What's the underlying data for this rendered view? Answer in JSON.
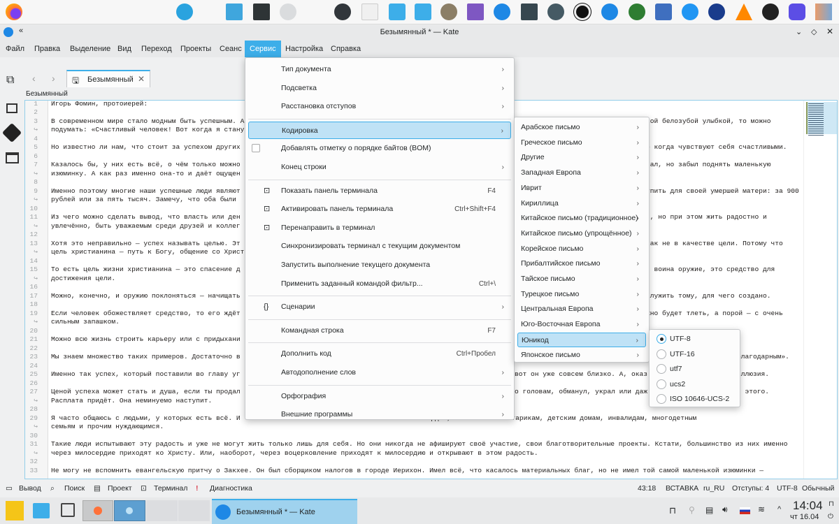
{
  "window": {
    "title": "Безымянный * — Kate"
  },
  "menubar": [
    "Файл",
    "Правка",
    "Выделение",
    "Вид",
    "Переход",
    "Проекты",
    "Сеанс",
    "Сервис",
    "Настройка",
    "Справка"
  ],
  "tab": {
    "label": "Безымянный"
  },
  "doc_label": "Безымянный",
  "editor": {
    "rows": [
      {
        "n": "1",
        "l": "Игорь Фомин, протоиерей:"
      },
      {
        "n": "2",
        "l": ""
      },
      {
        "n": "3",
        "l": "В современном мире стало модным быть успешным. А",
        "r": "кой белозубой улыбкой, то можно"
      },
      {
        "n": "↪",
        "l": "подумать: «Счастливый человек! Вот когда я стану"
      },
      {
        "n": "4",
        "l": ""
      },
      {
        "n": "5",
        "l": "Но известно ли нам, что стоит за успехом других",
        "r": "о когда чувствуют себя счастливыми."
      },
      {
        "n": "6",
        "l": ""
      },
      {
        "n": "7",
        "l": "Казалось бы, у них есть всё, о чём только можно",
        "r": "вал, но забыл поднять маленькую"
      },
      {
        "n": "↪",
        "l": "изюминку. А как раз именно она-то и даёт ощущен"
      },
      {
        "n": "8",
        "l": ""
      },
      {
        "n": "9",
        "l": "Именно поэтому многие наши успешные люди являют",
        "r": "упить для своей умершей матери: за 900"
      },
      {
        "n": "↪",
        "l": "рублей или за пять тысяч. Замечу, что оба были"
      },
      {
        "n": "10",
        "l": ""
      },
      {
        "n": "11",
        "l": "Из чего можно сделать вывод, что власть или ден",
        "r": "и, но при этом жить радостно и"
      },
      {
        "n": "↪",
        "l": "увлечённо, быть уважаемым среди друзей и коллег"
      },
      {
        "n": "12",
        "l": ""
      },
      {
        "n": "13",
        "l": "Хотя это неправильно — успех называть целью. Эт",
        "r": "как не в качестве цели. Потому что"
      },
      {
        "n": "↪",
        "l": "цель христианина — путь к Богу, общение со Христ"
      },
      {
        "n": "14",
        "l": ""
      },
      {
        "n": "15",
        "l": "То есть цель жизни христианина — это спасение д",
        "r": "и воина оружие, это средство для"
      },
      {
        "n": "↪",
        "l": "достижения цели."
      },
      {
        "n": "16",
        "l": ""
      },
      {
        "n": "17",
        "l": "Можно, конечно, и оружию поклоняться — начищать",
        "r": "служить тому, для чего создано."
      },
      {
        "n": "18",
        "l": ""
      },
      {
        "n": "19",
        "l": "Если человек обожествляет средство, то его ждёт",
        "r": "жно будет тлеть, а порой — с очень"
      },
      {
        "n": "↪",
        "l": "сильным запашком."
      },
      {
        "n": "20",
        "l": ""
      },
      {
        "n": "21",
        "l": "Можно всю жизнь строить карьеру или с придыхани"
      },
      {
        "n": "22",
        "l": ""
      },
      {
        "n": "23",
        "l": "Мы знаем множество таких примеров. Достаточно в",
        "r2": "благодарным»."
      },
      {
        "n": "24",
        "l": ""
      },
      {
        "n": "25",
        "l": "Именно так успех, который поставили во главу уг",
        "m": "вот он уже совсем близко. А, оказ",
        "r2": "иллюзия."
      },
      {
        "n": "26",
        "l": ""
      },
      {
        "n": "27",
        "l": "Ценой успеха может стать и душа, если ты продал",
        "m": "о головам, обманул, украл или даж",
        "r2": "и этого."
      },
      {
        "n": "↪",
        "l": "Расплата придёт. Она неминуемо наступит."
      },
      {
        "n": "28",
        "l": ""
      },
      {
        "n": "29",
        "l": "Я часто общаюсь с людьми, у которых есть всё. И",
        "b": "осердие, кто помогает старикам, детским домам, инвалидам, многодетным"
      },
      {
        "n": "↪",
        "l": "семьям и прочим нуждающимся."
      },
      {
        "n": "30",
        "l": ""
      },
      {
        "n": "31",
        "l": "Такие люди испытывают эту радость и уже не могут жить только лишь для себя. Но они никогда не афишируют своё участие, свои благотворительные проекты. Кстати, большинство из них именно"
      },
      {
        "n": "↪",
        "l": "через милосердие приходят ко Христу. Или, наоборот, через воцерковление приходят к милосердию и открывают в этом радость."
      },
      {
        "n": "32",
        "l": ""
      },
      {
        "n": "33",
        "l": "Не могу не вспомнить евангельскую притчу о Закхее. Он был сборщиком налогов в городе Иерихон. Имел всё, что касалось материальных благ, но не имел той самой маленькой изюминки —"
      }
    ]
  },
  "service_menu": [
    {
      "label": "Тип документа",
      "arrow": true
    },
    {
      "label": "Подсветка",
      "arrow": true
    },
    {
      "label": "Расстановка отступов",
      "arrow": true
    },
    {
      "sep": true
    },
    {
      "label": "Кодировка",
      "arrow": true,
      "highlighted": true
    },
    {
      "label": "Добавлять отметку о порядке байтов (BOM)",
      "checkbox": true
    },
    {
      "label": "Конец строки",
      "arrow": true
    },
    {
      "sep": true
    },
    {
      "label": "Показать панель терминала",
      "shortcut": "F4",
      "icon": "terminal-icon"
    },
    {
      "label": "Активировать панель терминала",
      "shortcut": "Ctrl+Shift+F4",
      "icon": "terminal-activate-icon"
    },
    {
      "label": "Перенаправить в терминал",
      "icon": "terminal-icon"
    },
    {
      "label": "Синхронизировать терминал с текущим документом"
    },
    {
      "label": "Запустить выполнение текущего документа"
    },
    {
      "label": "Применить заданный командой фильтр...",
      "shortcut": "Ctrl+\\"
    },
    {
      "sep": true
    },
    {
      "label": "Сценарии",
      "arrow": true,
      "icon": "braces-icon"
    },
    {
      "sep": true
    },
    {
      "label": "Командная строка",
      "shortcut": "F7"
    },
    {
      "sep": true
    },
    {
      "label": "Дополнить код",
      "shortcut": "Ctrl+Пробел"
    },
    {
      "label": "Автодополнение слов",
      "arrow": true
    },
    {
      "sep": true
    },
    {
      "label": "Орфография",
      "arrow": true
    },
    {
      "label": "Внешние программы",
      "arrow": true
    }
  ],
  "encoding_menu": [
    "Арабское письмо",
    "Греческое письмо",
    "Другие",
    "Западная Европа",
    "Иврит",
    "Кириллица",
    "Китайское письмо (традиционное)",
    "Китайское письмо (упрощённое)",
    "Корейское письмо",
    "Прибалтийское письмо",
    "Тайское письмо",
    "Турецкое письмо",
    "Центральная Европа",
    "Юго-Восточная Европа",
    "Юникод",
    "Японское письмо"
  ],
  "encoding_highlighted": "Юникод",
  "unicode_menu": [
    {
      "label": "UTF-8",
      "checked": true
    },
    {
      "label": "UTF-16"
    },
    {
      "label": "utf7"
    },
    {
      "label": "ucs2"
    },
    {
      "label": "ISO 10646-UCS-2"
    }
  ],
  "toolviews": [
    "Вывод",
    "Поиск",
    "Проект",
    "Терминал",
    "Диагностика"
  ],
  "status": {
    "cursor": "43:18",
    "mode": "ВСТАВКА",
    "lang": "ru_RU",
    "indent": "Отступы: 4",
    "encoding": "UTF-8",
    "highlight": "Обычный"
  },
  "taskbar": {
    "logo": "base alt",
    "task": "Безымянный * — Kate",
    "time": "14:04",
    "date": "чт 16.04"
  },
  "colors": {
    "accent": "#3daee9",
    "highlight": "#bfe2f6"
  }
}
